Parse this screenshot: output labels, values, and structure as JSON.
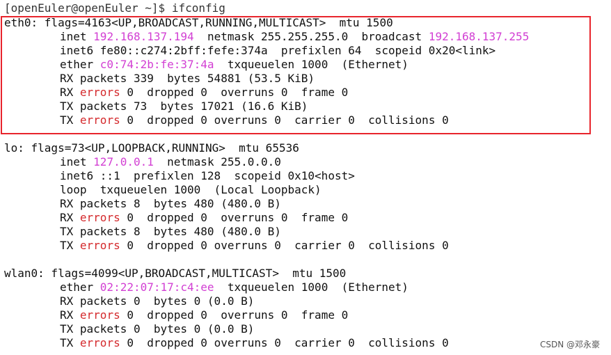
{
  "terminal": {
    "prompt_line": "[openEuler@openEuler ~]$ ifconfig",
    "eth0": {
      "header": "eth0: flags=4163<UP,BROADCAST,RUNNING,MULTICAST>  mtu 1500",
      "inet_label": "inet ",
      "inet_ip": "192.168.137.194",
      "netmask_text": "  netmask 255.255.255.0  broadcast ",
      "broadcast_ip": "192.168.137.255",
      "inet6_line": "inet6 fe80::c274:2bff:fefe:374a  prefixlen 64  scopeid 0x20<link>",
      "ether_label": "ether ",
      "ether_mac": "c0:74:2b:fe:37:4a",
      "ether_rest": "  txqueuelen 1000  (Ethernet)",
      "rx_packets": "RX packets 339  bytes 54881 (53.5 KiB)",
      "rx_err_prefix": "RX ",
      "rx_err_word": "errors",
      "rx_err_rest": " 0  dropped 0  overruns 0  frame 0",
      "tx_packets": "TX packets 73  bytes 17021 (16.6 KiB)",
      "tx_err_prefix": "TX ",
      "tx_err_word": "errors",
      "tx_err_rest": " 0  dropped 0 overruns 0  carrier 0  collisions 0"
    },
    "lo": {
      "header": "lo: flags=73<UP,LOOPBACK,RUNNING>  mtu 65536",
      "inet_label": "inet ",
      "inet_ip": "127.0.0.1",
      "netmask_text": "  netmask 255.0.0.0",
      "inet6_line": "inet6 ::1  prefixlen 128  scopeid 0x10<host>",
      "loop_line": "loop  txqueuelen 1000  (Local Loopback)",
      "rx_packets": "RX packets 8  bytes 480 (480.0 B)",
      "rx_err_prefix": "RX ",
      "rx_err_word": "errors",
      "rx_err_rest": " 0  dropped 0  overruns 0  frame 0",
      "tx_packets": "TX packets 8  bytes 480 (480.0 B)",
      "tx_err_prefix": "TX ",
      "tx_err_word": "errors",
      "tx_err_rest": " 0  dropped 0 overruns 0  carrier 0  collisions 0"
    },
    "wlan0": {
      "header": "wlan0: flags=4099<UP,BROADCAST,MULTICAST>  mtu 1500",
      "ether_label": "ether ",
      "ether_mac": "02:22:07:17:c4:ee",
      "ether_rest": "  txqueuelen 1000  (Ethernet)",
      "rx_packets": "RX packets 0  bytes 0 (0.0 B)",
      "rx_err_prefix": "RX ",
      "rx_err_word": "errors",
      "rx_err_rest": " 0  dropped 0  overruns 0  frame 0",
      "tx_packets": "TX packets 0  bytes 0 (0.0 B)",
      "tx_err_prefix": "TX ",
      "tx_err_word": "errors",
      "tx_err_rest": " 0  dropped 0 overruns 0  carrier 0  collisions 0"
    }
  },
  "watermark": "CSDN @邓永豪",
  "colors": {
    "highlight_box": "#e8242c",
    "address_magenta": "#d23fd3",
    "error_red": "#d4292c"
  }
}
